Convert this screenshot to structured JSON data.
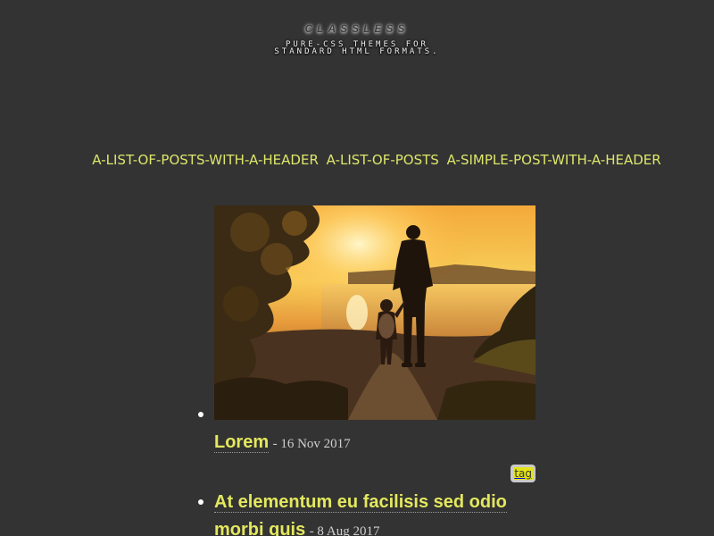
{
  "header": {
    "title": "CLASSLESS",
    "tagline": "PURE-CSS THEMES FOR STANDARD HTML FORMATS."
  },
  "nav": {
    "links": [
      {
        "label": "A-LIST-OF-POSTS-WITH-A-HEADER"
      },
      {
        "label": "A-LIST-OF-POSTS"
      },
      {
        "label": "A-SIMPLE-POST-WITH-A-HEADER"
      }
    ]
  },
  "posts": [
    {
      "title": "Lorem",
      "date": "- 16 Nov 2017",
      "tag": "tag",
      "image_description": "silhouette of adult and child walking at sunset"
    },
    {
      "title": "At elementum eu facilisis sed odio morbi quis",
      "date": "- 8 Aug 2017"
    }
  ],
  "colors": {
    "background": "#333333",
    "link": "#dde66a",
    "post_title": "#e4e85e",
    "tag_highlight": "#e3e316"
  }
}
